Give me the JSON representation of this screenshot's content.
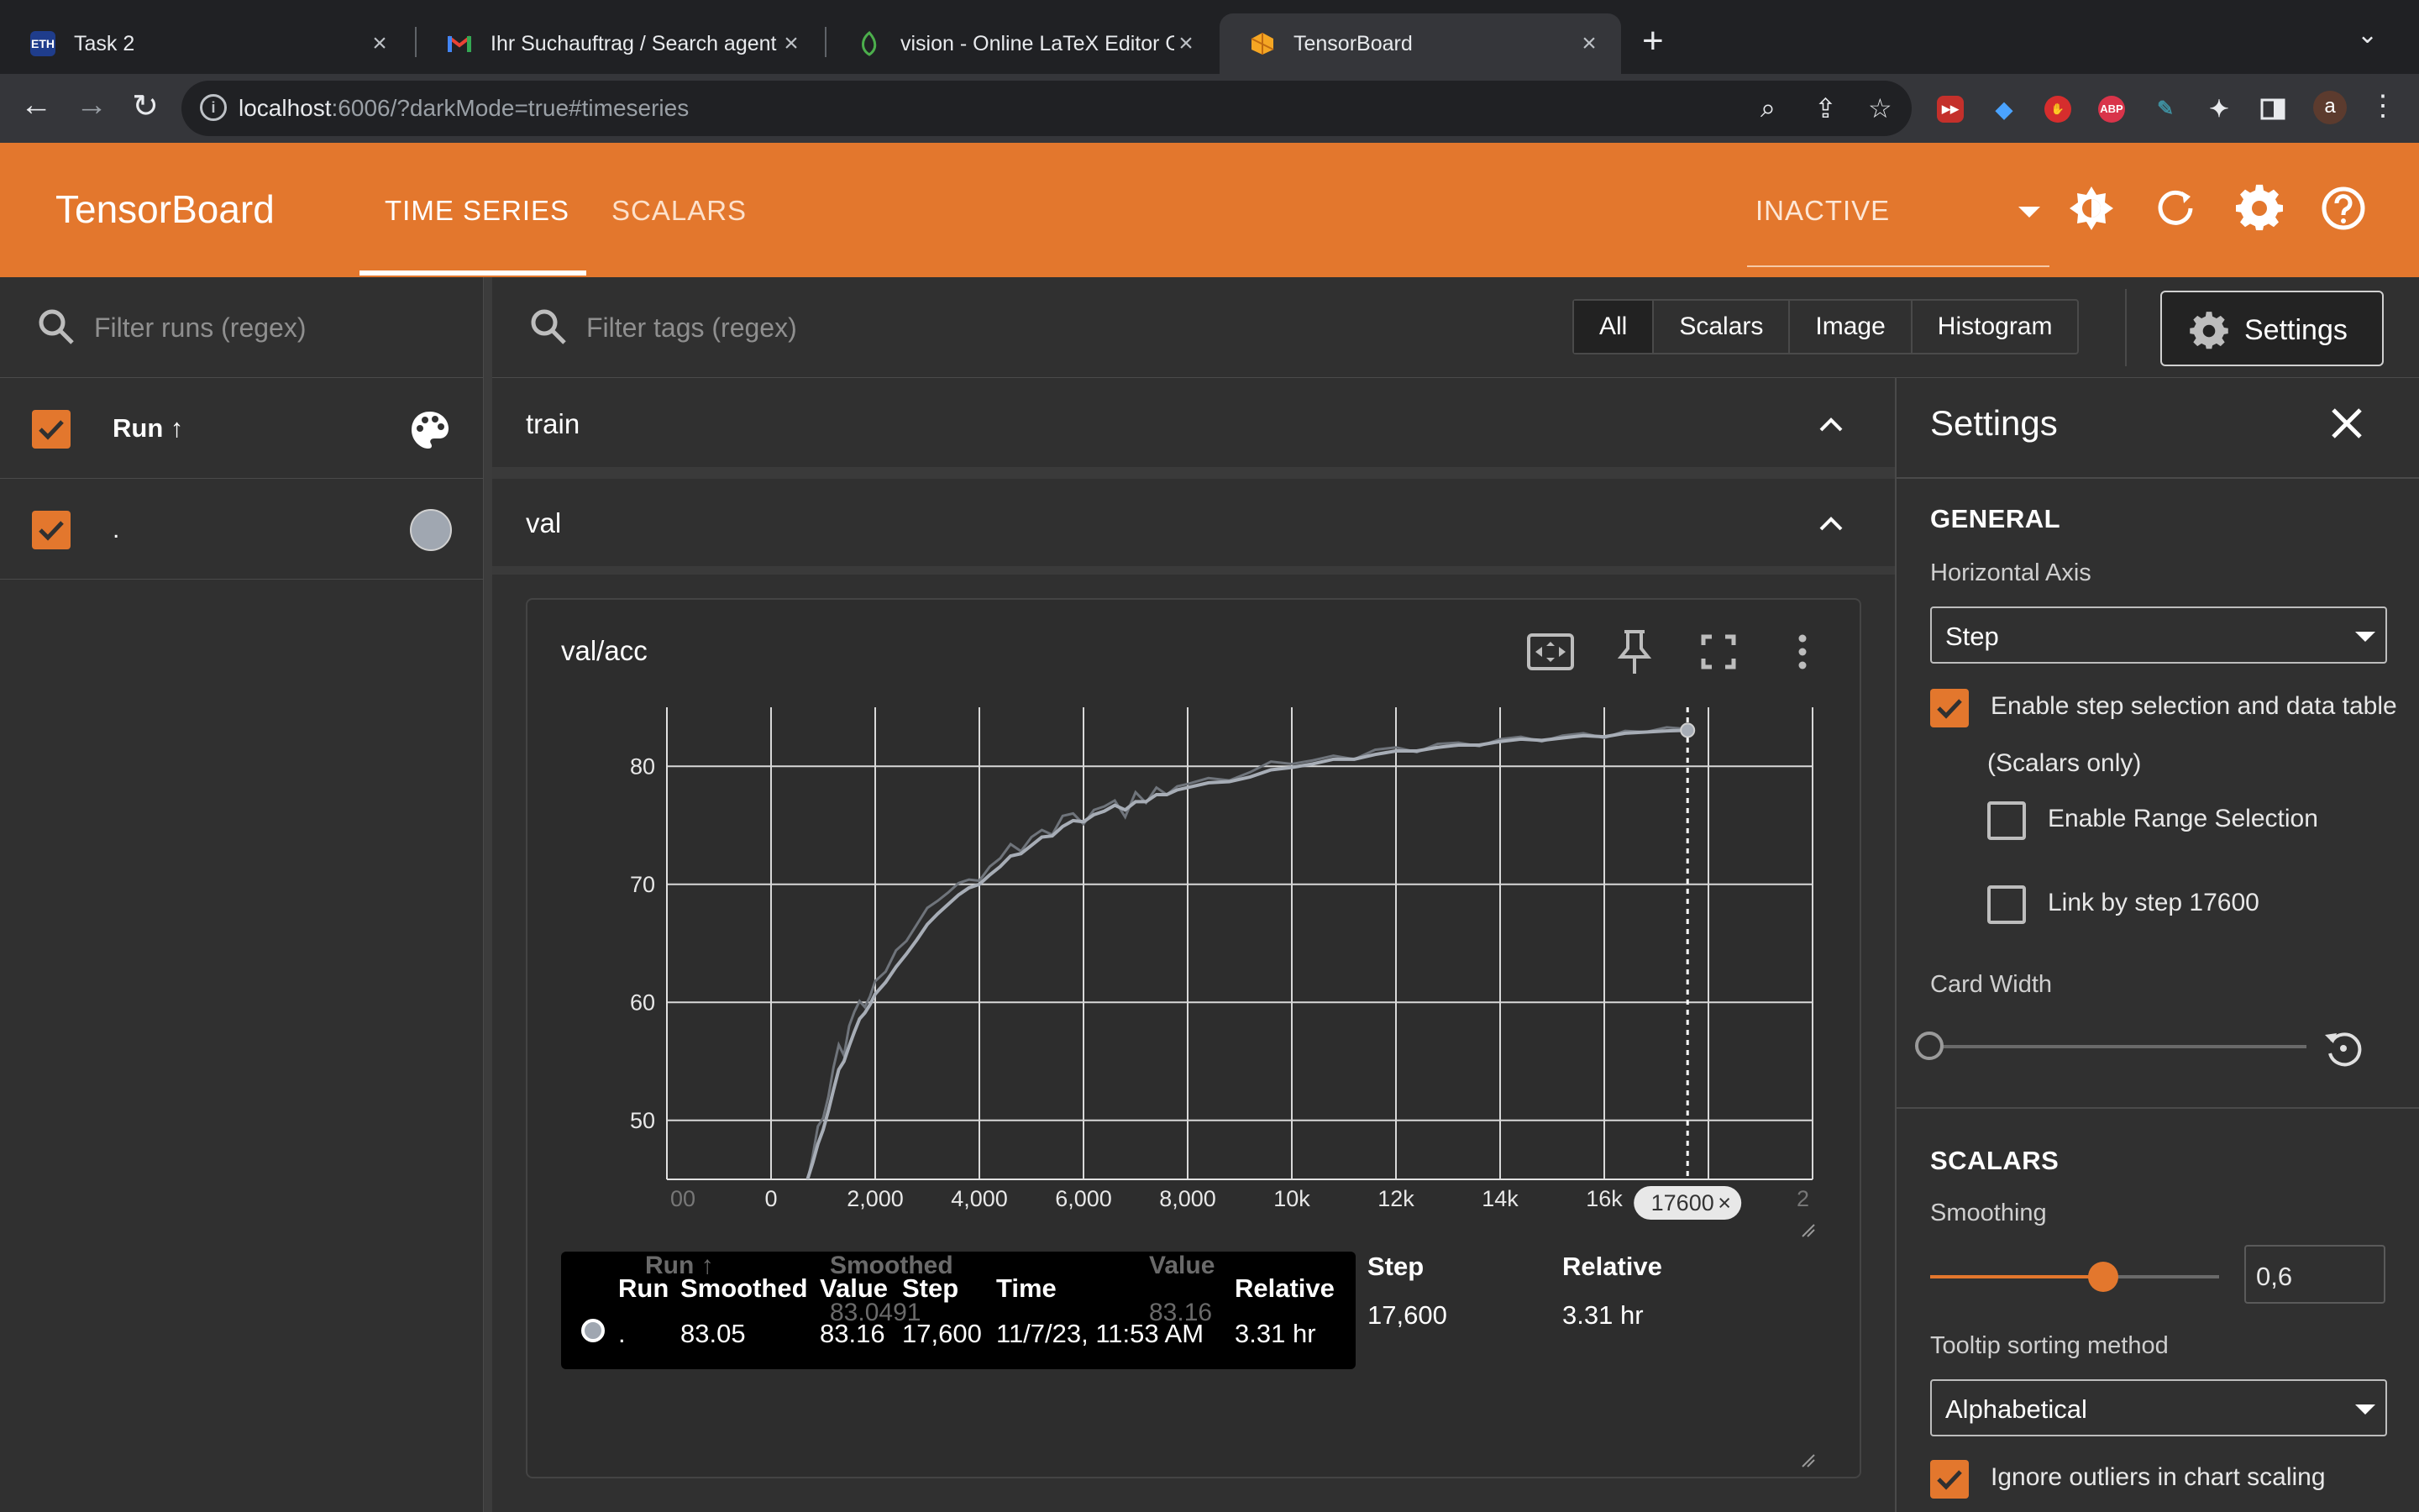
{
  "browser": {
    "tabs": [
      {
        "title": "Task 2",
        "favicon": "eth-icon"
      },
      {
        "title": "Ihr Suchauftrag / Search agent",
        "favicon": "gmail-icon"
      },
      {
        "title": "vision - Online LaTeX Editor Ov",
        "favicon": "overleaf-icon"
      },
      {
        "title": "TensorBoard",
        "favicon": "tensorboard-icon"
      }
    ],
    "url_host": "localhost",
    "url_rest": ":6006/?darkMode=true#timeseries",
    "profile_initial": "a",
    "extensions": [
      "youtube-icon",
      "diamond-icon",
      "hand-icon",
      "ABP",
      "reader-icon",
      "puzzle-icon",
      "sidepanel-icon"
    ]
  },
  "header": {
    "brand": "TensorBoard",
    "tabs": [
      "TIME SERIES",
      "SCALARS"
    ],
    "reload_status": "INACTIVE"
  },
  "runs": {
    "filter_placeholder": "Filter runs (regex)",
    "header_label": "Run ↑",
    "items": [
      {
        "name": "."
      }
    ]
  },
  "main": {
    "filter_placeholder": "Filter tags (regex)",
    "type_filters": [
      "All",
      "Scalars",
      "Image",
      "Histogram"
    ],
    "settings_button": "Settings",
    "groups": [
      "train",
      "val"
    ]
  },
  "card": {
    "title": "val/acc",
    "selected_step_chip": "17600",
    "table": {
      "ghost_headers": [
        "Run ↑",
        "Smoothed",
        "Value"
      ],
      "ghost_values": [
        "83.0491",
        "83.16"
      ],
      "headers": [
        "Run",
        "Smoothed",
        "Value",
        "Step",
        "Time",
        "Relative"
      ],
      "row": {
        "run": ".",
        "smoothed": "83.05",
        "value": "83.16",
        "step": "17,600",
        "time": "11/7/23, 11:53 AM",
        "relative": "3.31 hr"
      },
      "extra_headers": [
        "Step",
        "Relative"
      ],
      "extra_values": [
        "17,600",
        "3.31 hr"
      ]
    }
  },
  "chart_data": {
    "type": "line",
    "title": "val/acc",
    "xlabel": "",
    "ylabel": "",
    "x_tick_labels": [
      "00",
      "0",
      "2,000",
      "4,000",
      "6,000",
      "8,000",
      "10k",
      "12k",
      "14k",
      "16k",
      "2"
    ],
    "x_ticks": [
      -2000,
      0,
      2000,
      4000,
      6000,
      8000,
      10000,
      12000,
      14000,
      16000,
      18000
    ],
    "y_ticks": [
      50,
      60,
      70,
      80
    ],
    "xlim": [
      -2000,
      20000
    ],
    "ylim": [
      45,
      85
    ],
    "grid": true,
    "selected_step": 17600,
    "series": [
      {
        "values_x": [
          700,
          800,
          900,
          1000,
          1100,
          1200,
          1300,
          1400,
          1500,
          1600,
          1700,
          1800,
          1900,
          2000,
          2200,
          2400,
          2600,
          2800,
          3000,
          3200,
          3400,
          3600,
          3800,
          4000,
          4200,
          4400,
          4600,
          4800,
          5000,
          5200,
          5400,
          5600,
          5800,
          6000,
          6200,
          6400,
          6600,
          6800,
          7000,
          7200,
          7400,
          7600,
          7800,
          8000,
          8400,
          8800,
          9200,
          9600,
          10000,
          10400,
          10800,
          11200,
          11600,
          12000,
          12400,
          12800,
          13200,
          13600,
          14000,
          14400,
          14800,
          15200,
          15600,
          16000,
          16400,
          16800,
          17200,
          17600
        ],
        "raw": [
          44.8,
          47.0,
          49.5,
          50.2,
          52.0,
          54.5,
          56.4,
          55.5,
          58.0,
          59.2,
          60.1,
          59.6,
          60.5,
          61.8,
          62.6,
          64.4,
          65.2,
          66.6,
          68.0,
          68.6,
          69.3,
          70.1,
          70.4,
          70.3,
          71.5,
          72.2,
          73.4,
          72.8,
          74.0,
          74.6,
          74.2,
          75.8,
          76.0,
          75.1,
          76.3,
          76.6,
          77.1,
          75.7,
          77.8,
          76.9,
          78.2,
          77.6,
          78.3,
          78.5,
          79.0,
          78.8,
          79.5,
          80.4,
          80.2,
          80.5,
          80.9,
          80.6,
          81.4,
          81.6,
          81.2,
          81.9,
          82.0,
          81.7,
          82.3,
          82.5,
          82.1,
          82.6,
          82.8,
          82.4,
          83.0,
          82.9,
          83.3,
          83.16
        ],
        "smoothed": [
          45.0,
          46.4,
          48.0,
          49.2,
          50.8,
          52.6,
          54.3,
          55.0,
          56.3,
          57.5,
          58.6,
          59.1,
          59.8,
          60.7,
          61.7,
          63.0,
          64.1,
          65.3,
          66.6,
          67.5,
          68.3,
          69.1,
          69.7,
          70.0,
          70.8,
          71.5,
          72.4,
          72.6,
          73.3,
          74.0,
          74.1,
          74.9,
          75.4,
          75.3,
          75.9,
          76.2,
          76.7,
          76.3,
          77.0,
          77.0,
          77.6,
          77.6,
          78.0,
          78.2,
          78.6,
          78.7,
          79.1,
          79.7,
          79.9,
          80.2,
          80.6,
          80.6,
          81.0,
          81.3,
          81.3,
          81.6,
          81.8,
          81.8,
          82.1,
          82.3,
          82.2,
          82.4,
          82.6,
          82.5,
          82.8,
          82.9,
          83.0,
          83.05
        ]
      }
    ]
  },
  "settings": {
    "title": "Settings",
    "general": "GENERAL",
    "horizontal_axis_label": "Horizontal Axis",
    "horizontal_axis_value": "Step",
    "enable_step_selection": "Enable step selection and data table",
    "scalars_only": "(Scalars only)",
    "enable_range_selection": "Enable Range Selection",
    "link_by_step": "Link by step 17600",
    "card_width": "Card Width",
    "scalars": "SCALARS",
    "smoothing_label": "Smoothing",
    "smoothing_value": "0,6",
    "smoothing_fraction": 0.6,
    "tooltip_sort_label": "Tooltip sorting method",
    "tooltip_sort_value": "Alphabetical",
    "ignore_outliers": "Ignore outliers in chart scaling"
  },
  "colors": {
    "accent": "#e3772d",
    "run_color": "#a0a7b1"
  }
}
